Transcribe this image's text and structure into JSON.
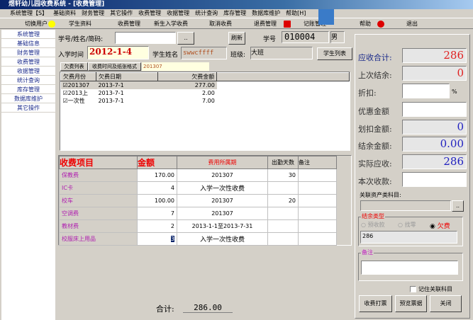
{
  "window": {
    "title": "煜轩幼儿园收费系统 - [收费管理]"
  },
  "menu": [
    "系统管理【S】",
    "基础资料",
    "财务管理",
    "其它操作",
    "收费管理",
    "收据管理",
    "统计查询",
    "库存管理",
    "数据库维护",
    "帮助[H]"
  ],
  "toolbar": [
    "切换用户",
    "学生资料",
    "收费管理",
    "新生入学收费",
    "取消收费",
    "退费管理",
    "记账管理",
    "帮助",
    "退出"
  ],
  "sidebar": [
    "系统管理",
    "基础信息",
    "财务管理",
    "收费管理",
    "收据管理",
    "统计查询",
    "库存管理",
    "数据库维护",
    "其它操作"
  ],
  "form": {
    "search_label": "学号/姓名/简码:",
    "search_value": "",
    "browse": "..",
    "refresh": "刷新",
    "id_label": "学号",
    "id_value": "010004",
    "gender": "男",
    "enroll_label": "入学时间",
    "enroll_value": "2012-1-4",
    "name_label": "学生姓名",
    "name_value": "swwcffff",
    "class_label": "班级:",
    "class_value": "大班",
    "student_list": "学生列表"
  },
  "tabs": {
    "tab1": "欠费列表",
    "tab2": "收费时间及纸张格式",
    "month": "201307"
  },
  "owe": {
    "headers": [
      "欠费月份",
      "欠费日期",
      "欠费金额"
    ],
    "rows": [
      [
        "201307",
        "2013-7-1",
        "277.00"
      ],
      [
        "2013上",
        "2013-7-1",
        "2.00"
      ],
      [
        "一次性",
        "2013-7-1",
        "7.00"
      ]
    ]
  },
  "fees": {
    "headers": [
      "收费项目",
      "金额",
      "费用所属期",
      "出勤天数",
      "备注"
    ],
    "rows": [
      [
        "保教费",
        "170.00",
        "201307",
        "30",
        ""
      ],
      [
        "IC卡",
        "4",
        "入学一次性收费",
        "",
        ""
      ],
      [
        "校车",
        "100.00",
        "201307",
        "20",
        ""
      ],
      [
        "空调费",
        "7",
        "201307",
        "",
        ""
      ],
      [
        "教材费",
        "2",
        "2013-1-1至2013-7-31",
        "",
        ""
      ],
      [
        "校服床上用品",
        "3",
        "入学一次性收费",
        "",
        ""
      ]
    ]
  },
  "total": {
    "label": "合计:",
    "value": "286.00"
  },
  "right": {
    "due_label": "应收合计:",
    "due": "286",
    "last_label": "上次结余:",
    "last": "0",
    "disc_label": "折扣:",
    "disc": "",
    "pct": "%",
    "pref_label": "优惠金额",
    "pref": "",
    "deduct_label": "划扣金额:",
    "deduct": "0",
    "bal_label": "结余金额:",
    "bal": "0.00",
    "actual_label": "实际应收:",
    "actual": "286",
    "pay_label": "本次收款:",
    "pay": "",
    "asset_label": "关联资产类科目:",
    "asset": "",
    "asset_btn": "..",
    "bal_type_label": "结余类型",
    "opt1": "预收款",
    "opt2": "找零",
    "opt3": "欠费",
    "bal_type_value": "286",
    "note_label": "备注",
    "note": "",
    "remember": "记住关联科目",
    "btn_print": "收费打票",
    "btn_preview": "预览票据",
    "btn_close": "关闭"
  }
}
